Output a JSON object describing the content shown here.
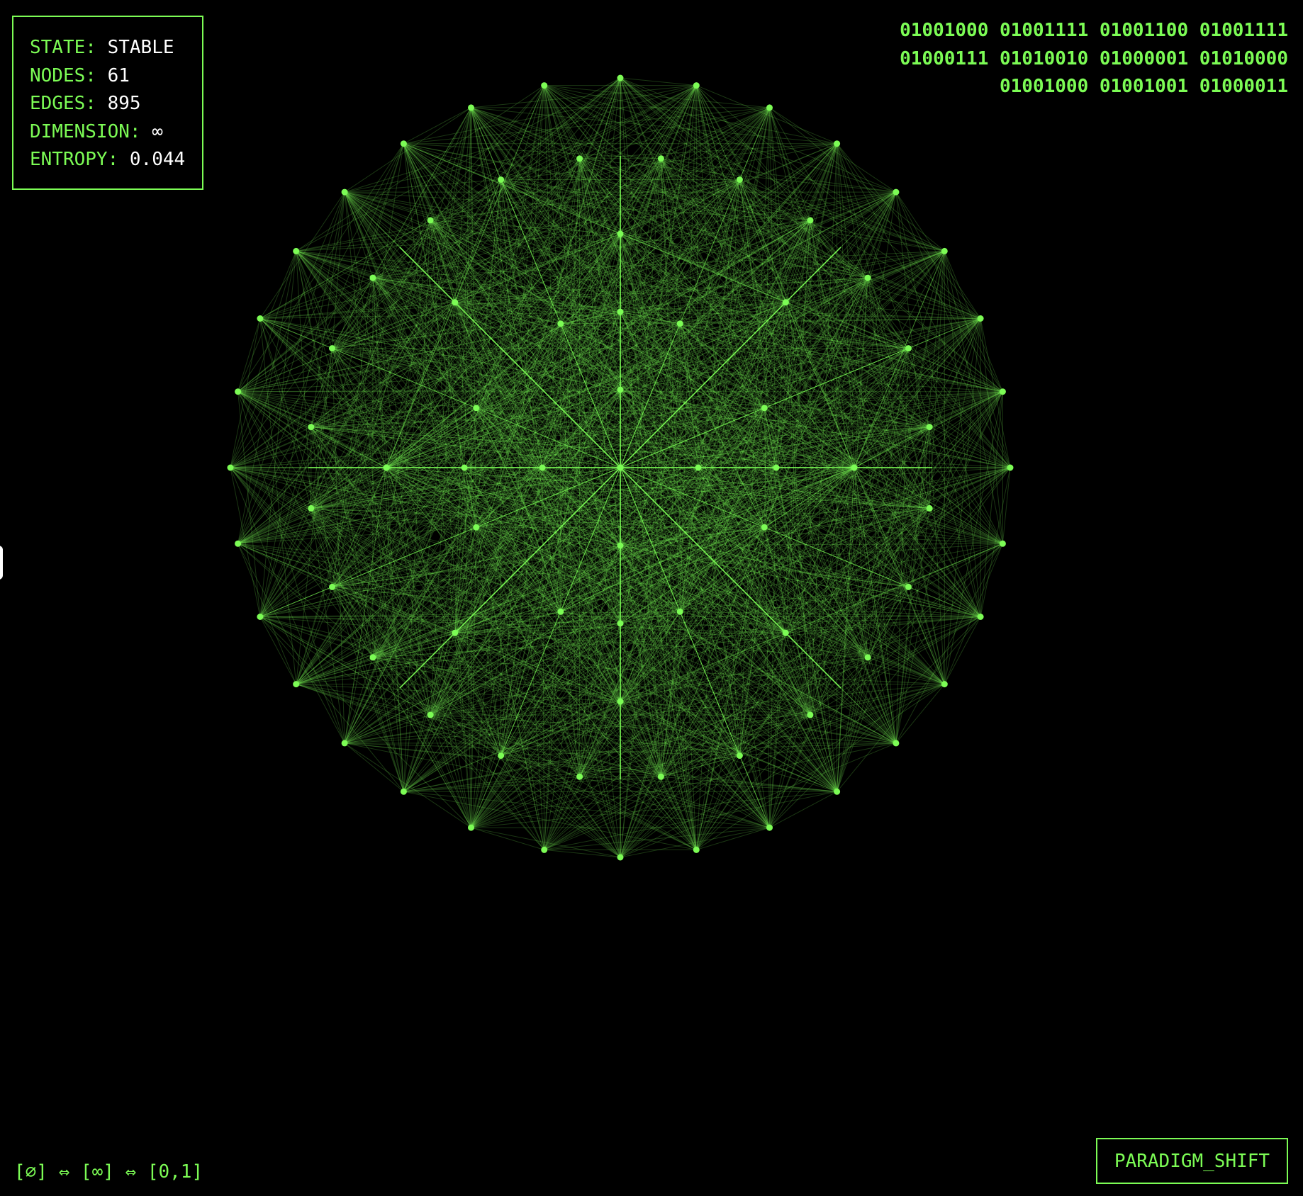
{
  "stats": {
    "state_label": "STATE:",
    "state_value": "STABLE",
    "nodes_label": "NODES:",
    "nodes_value": "61",
    "edges_label": "EDGES:",
    "edges_value": "895",
    "dimension_label": "DIMENSION:",
    "dimension_value": "∞",
    "entropy_label": "ENTROPY:",
    "entropy_value": "0.044"
  },
  "binary": {
    "line1": "01001000 01001111 01001100 01001111",
    "line2": "01000111 01010010 01000001 01010000",
    "line3": "01001000 01001001 01000011"
  },
  "formula": "[∅] ⇔ [∞] ⇔ [0,1]",
  "button": {
    "label": "PARADIGM_SHIFT"
  },
  "colors": {
    "accent": "#7CFC55",
    "background": "#000000",
    "value_text": "#ffffff"
  }
}
